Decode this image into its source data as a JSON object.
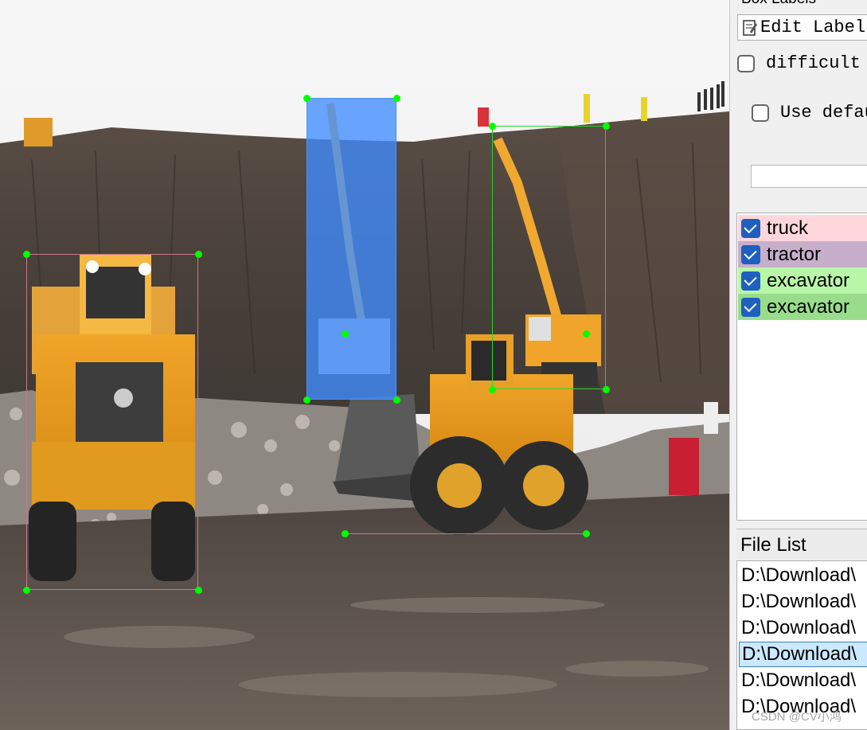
{
  "dock": {
    "title": "Box Labels",
    "edit_label_button": "Edit Label",
    "difficult_label": "difficult",
    "use_default_label": "Use defau",
    "default_label_value": ""
  },
  "label_list": {
    "items": [
      {
        "label": "truck",
        "checked": true,
        "color": "#ffd6dc"
      },
      {
        "label": "tractor",
        "checked": true,
        "color": "#c7aecb"
      },
      {
        "label": "excavator",
        "checked": true,
        "color": "#b8f6a8"
      },
      {
        "label": "excavator",
        "checked": true,
        "color": "#99dd8c"
      }
    ]
  },
  "file_list": {
    "header": "File List",
    "items": [
      {
        "path": "D:\\Download\\",
        "selected": false
      },
      {
        "path": "D:\\Download\\",
        "selected": false
      },
      {
        "path": "D:\\Download\\",
        "selected": false
      },
      {
        "path": "D:\\Download\\",
        "selected": true
      },
      {
        "path": "D:\\Download\\",
        "selected": false
      },
      {
        "path": "D:\\Download\\",
        "selected": false
      }
    ]
  },
  "watermark": "CSDN @CV小鸿",
  "colors": {
    "handle": "#00ff00",
    "selected_box_fill": "#408cff",
    "checkbox_blue": "#1f5fbf"
  },
  "icons": {
    "edit_label_button": "pencil-note-icon",
    "checkbox": "check-icon"
  }
}
